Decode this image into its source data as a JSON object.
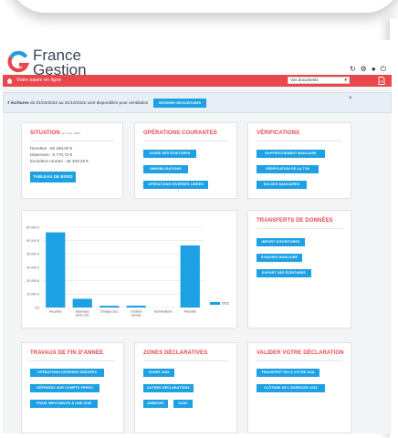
{
  "brand": {
    "line1": "France",
    "line2": "Gestion"
  },
  "header": {
    "icons": [
      "refresh-icon",
      "gears-icon",
      "user-icon",
      "power-icon"
    ]
  },
  "toolbar": {
    "user_label": "Votre saisie en ligne",
    "documents_select": "Vos documents",
    "colors": {
      "red": "#e8474b",
      "blue": "#1da1e4"
    }
  },
  "banner": {
    "count": "7 écritures",
    "text": " du 01/04/2022 au 01/10/2022 sont disponibles pour ventilation",
    "button": "INTÉGRER CES ÉCRITURES",
    "close": "×"
  },
  "situation": {
    "title": "SITUATION",
    "date": "au 3 oct. 2022",
    "recettes": "Recettes : 56 180,00 €",
    "depenses": "Dépenses : 9 770,72 €",
    "excedent": "Excédent courant : 46 409,28 €",
    "button": "TABLEAU DE BORD"
  },
  "operations": {
    "title": "OPÉRATIONS COURANTES",
    "buttons": [
      "SAISIE DES ÉCRITURES",
      "IMMOBILISATIONS",
      "OPÉRATIONS DIVERSES LIBRES"
    ]
  },
  "verifications": {
    "title": "VÉRIFICATIONS",
    "buttons": [
      "RAPPROCHEMENT BANCAIRE",
      "VÉRIFICATION DE LA TVA",
      "SOLDES BANCAIRES"
    ]
  },
  "transferts": {
    "title": "TRANSFERTS DE DONNÉES",
    "buttons": [
      "IMPORT D'ÉCRITURES",
      "SYNCHRO BANCAIRE",
      "EXPORT DES ÉCRITURES"
    ]
  },
  "travaux": {
    "title": "TRAVAUX DE FIN D'ANNÉE",
    "buttons": [
      "OPÉRATIONS DIVERSES DIRIGÉES",
      "DÉPENSES SUR COMPTE PERSO",
      "FRAIS IMPUTABLES À UNE SCM"
    ]
  },
  "zones": {
    "title": "ZONES DÉCLARATIVES",
    "buttons": [
      "ZONES 2035",
      "AUTRES DÉCLARATIONS",
      "ANNEXES",
      "DAS2"
    ]
  },
  "valider": {
    "title": "VALIDER VOTRE DÉCLARATION",
    "buttons": [
      "TRANSFERT EDI À VOTRE AGA",
      "CLÔTURE DE L'EXERCICE 2022"
    ]
  },
  "chart_data": {
    "type": "bar",
    "categories": [
      "Recettes",
      "Dépenses\n(hors CE)",
      "Charges soc.",
      "Cotation\nannuel",
      "Exonérations",
      "Résultat"
    ],
    "series": [
      {
        "name": "2022",
        "values": [
          56180,
          6500,
          1300,
          1400,
          0,
          46400
        ]
      }
    ],
    "ylim": [
      0,
      60000
    ],
    "yticks": [
      "0 €",
      "10 000 €",
      "20 000 €",
      "30 000 €",
      "40 000 €",
      "50 000 €",
      "60 000 €"
    ],
    "grid": true,
    "legend": "right",
    "color": "#1da1e4"
  }
}
